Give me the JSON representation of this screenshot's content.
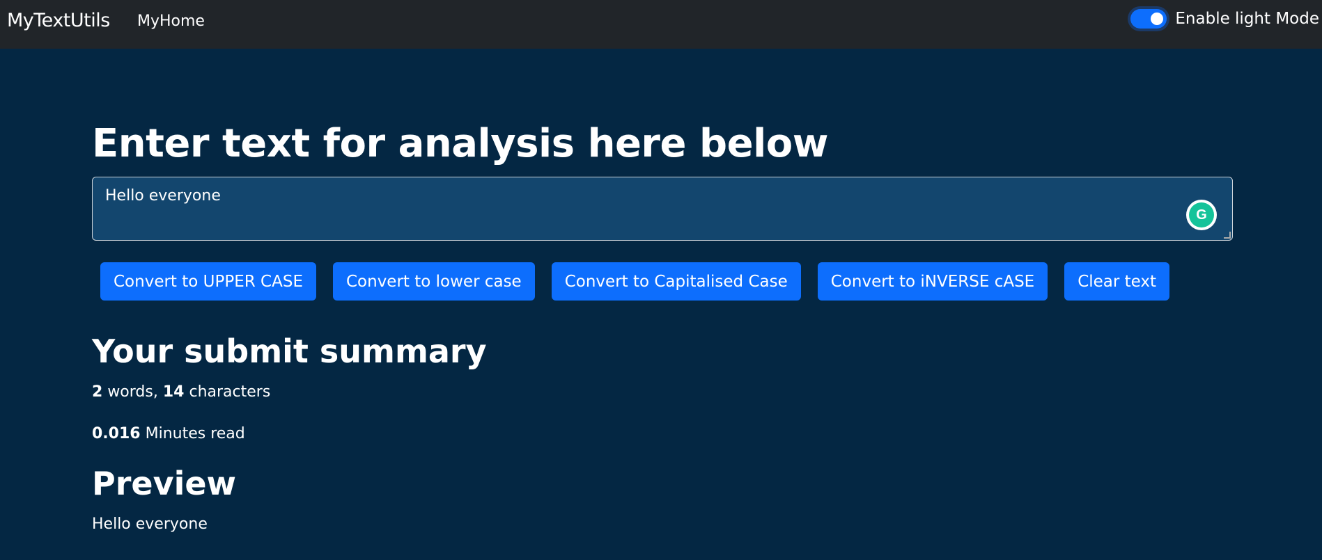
{
  "navbar": {
    "brand": "MyTextUtils",
    "link": "MyHome",
    "mode_toggle_label": "Enable light Mode",
    "mode_toggle_on": true
  },
  "main": {
    "heading": "Enter text for analysis here below",
    "textarea_value": "Hello everyone",
    "buttons": [
      "Convert to UPPER CASE",
      "Convert to lower case",
      "Convert to Capitalised Case",
      "Convert to iNVERSE cASE",
      "Clear text"
    ],
    "summary_title": "Your submit summary",
    "word_count": "2",
    "words_label": "words,",
    "char_count": "14",
    "chars_label": "characters",
    "minutes": "0.016",
    "minutes_label": "Minutes read",
    "preview_title": "Preview",
    "preview_text": "Hello everyone"
  },
  "colors": {
    "navbar_bg": "#212529",
    "page_bg": "#042743",
    "textarea_bg": "#13466e",
    "button_bg": "#0d6efd"
  }
}
